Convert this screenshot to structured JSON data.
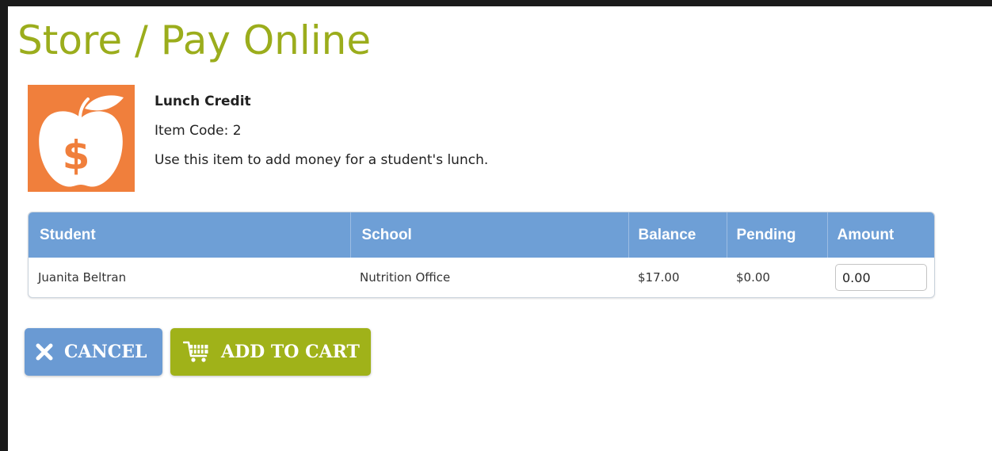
{
  "page": {
    "title": "Store / Pay Online"
  },
  "item": {
    "image_icon": "apple-dollar-icon",
    "name": "Lunch Credit",
    "code": "Item Code: 2",
    "description": "Use this item to add money for a student's lunch."
  },
  "table": {
    "headers": {
      "student": "Student",
      "school": "School",
      "balance": "Balance",
      "pending": "Pending",
      "amount": "Amount"
    },
    "rows": [
      {
        "student": "Juanita Beltran",
        "school": "Nutrition Office",
        "balance": "$17.00",
        "pending": "$0.00",
        "amount": "0.00"
      }
    ]
  },
  "actions": {
    "cancel_label": "CANCEL",
    "cancel_icon": "x-icon",
    "add_to_cart_label": "ADD TO CART",
    "add_to_cart_icon": "shopping-cart-icon"
  },
  "colors": {
    "title": "#9bad1c",
    "item_image_bg": "#f07f3c",
    "table_header": "#6e9fd6",
    "cancel_button": "#6a9ad3",
    "add_to_cart_button": "#a0b219"
  }
}
